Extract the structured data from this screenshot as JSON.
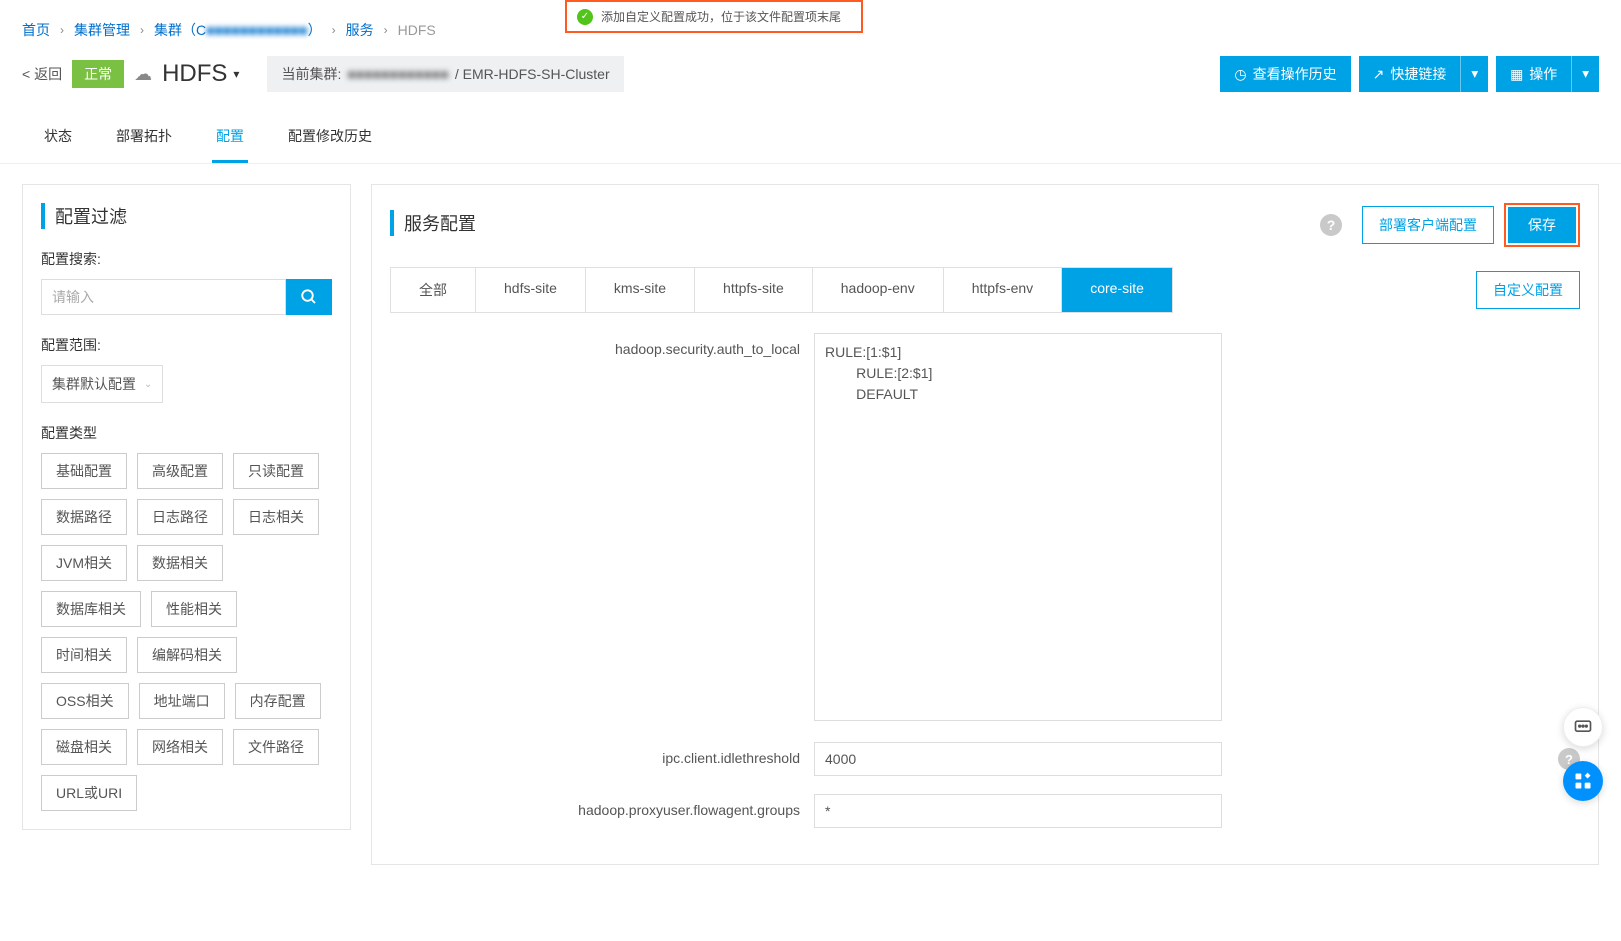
{
  "breadcrumb": {
    "home": "首页",
    "cluster_mgmt": "集群管理",
    "cluster_prefix": "集群（C",
    "cluster_blur": "■■■■■■■■■■■■",
    "cluster_suffix": "）",
    "service": "服务",
    "current": "HDFS"
  },
  "toast": {
    "text": "添加自定义配置成功，位于该文件配置项末尾"
  },
  "header": {
    "back": "< 返回",
    "status": "正常",
    "service_name": "HDFS",
    "cluster_label": "当前集群:",
    "cluster_blur": "■■■■■■■■■■■■",
    "cluster_name": "/ EMR-HDFS-SH-Cluster",
    "btn_history": "查看操作历史",
    "btn_quicklinks": "快捷链接",
    "btn_ops": "操作"
  },
  "tabs": {
    "status": "状态",
    "topology": "部署拓扑",
    "config": "配置",
    "history": "配置修改历史"
  },
  "filter": {
    "title": "配置过滤",
    "search_label": "配置搜索:",
    "search_placeholder": "请输入",
    "scope_label": "配置范围:",
    "scope_value": "集群默认配置",
    "type_label": "配置类型",
    "tags": [
      "基础配置",
      "高级配置",
      "只读配置",
      "数据路径",
      "日志路径",
      "日志相关",
      "JVM相关",
      "数据相关",
      "数据库相关",
      "性能相关",
      "时间相关",
      "编解码相关",
      "OSS相关",
      "地址端口",
      "内存配置",
      "磁盘相关",
      "网络相关",
      "文件路径",
      "URL或URI"
    ]
  },
  "config": {
    "title": "服务配置",
    "btn_deploy": "部署客户端配置",
    "btn_save": "保存",
    "btn_custom": "自定义配置",
    "file_tabs": [
      "全部",
      "hdfs-site",
      "kms-site",
      "httpfs-site",
      "hadoop-env",
      "httpfs-env",
      "core-site"
    ],
    "rows": {
      "r0_key": "hadoop.security.auth_to_local",
      "r0_val": "RULE:[1:$1]\n        RULE:[2:$1]\n        DEFAULT",
      "r1_key": "ipc.client.idlethreshold",
      "r1_val": "4000",
      "r2_key": "hadoop.proxyuser.flowagent.groups",
      "r2_val": "*"
    }
  }
}
